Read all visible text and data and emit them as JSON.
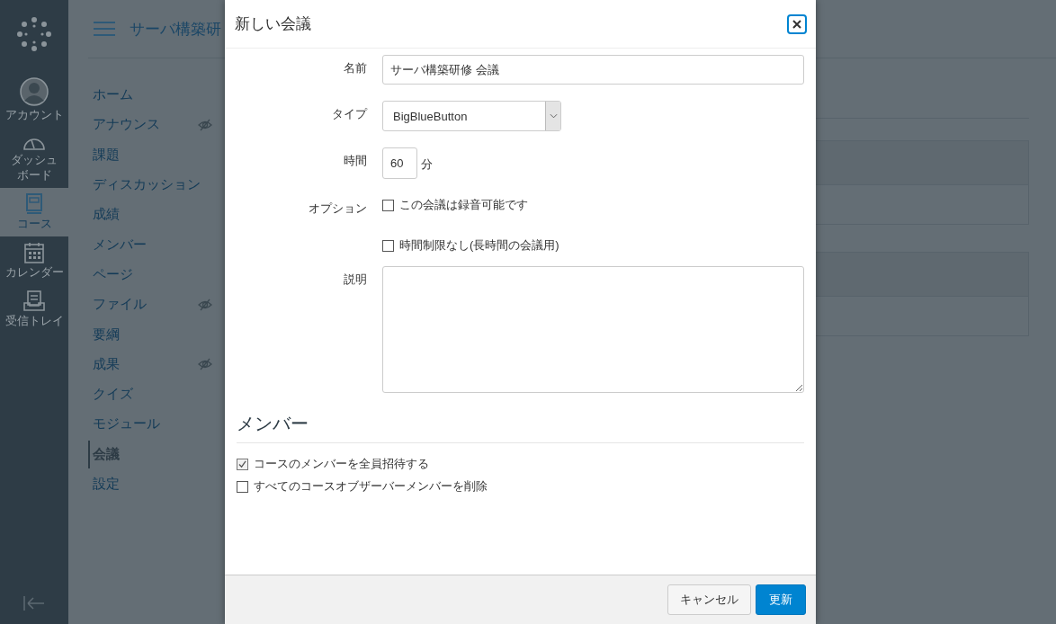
{
  "global_nav": {
    "items": [
      {
        "kind": "account",
        "label": "アカウント",
        "selected": false
      },
      {
        "kind": "dashboard",
        "label": "ダッシュボード",
        "selected": false
      },
      {
        "kind": "courses",
        "label": "コース",
        "selected": true
      },
      {
        "kind": "calendar",
        "label": "カレンダー",
        "selected": false
      },
      {
        "kind": "inbox",
        "label": "受信トレイ",
        "selected": false
      }
    ]
  },
  "course": {
    "title": "サーバ構築研"
  },
  "course_nav": {
    "items": [
      {
        "label": "ホーム",
        "hidden": false,
        "selected": false
      },
      {
        "label": "アナウンス",
        "hidden": true,
        "selected": false
      },
      {
        "label": "課題",
        "hidden": false,
        "selected": false
      },
      {
        "label": "ディスカッション",
        "hidden": false,
        "selected": false
      },
      {
        "label": "成績",
        "hidden": false,
        "selected": false
      },
      {
        "label": "メンバー",
        "hidden": false,
        "selected": false
      },
      {
        "label": "ページ",
        "hidden": false,
        "selected": false
      },
      {
        "label": "ファイル",
        "hidden": true,
        "selected": false
      },
      {
        "label": "要綱",
        "hidden": false,
        "selected": false
      },
      {
        "label": "成果",
        "hidden": true,
        "selected": false
      },
      {
        "label": "クイズ",
        "hidden": false,
        "selected": false
      },
      {
        "label": "モジュール",
        "hidden": false,
        "selected": false
      },
      {
        "label": "会議",
        "hidden": false,
        "selected": true
      },
      {
        "label": "設定",
        "hidden": false,
        "selected": false
      }
    ]
  },
  "dialog": {
    "title": "新しい会議",
    "name": {
      "label": "名前",
      "value": "サーバ構築研修 会議"
    },
    "type": {
      "label": "タイプ",
      "value": "BigBlueButton"
    },
    "duration": {
      "label": "時間",
      "value": "60",
      "unit": "分"
    },
    "options": {
      "label": "オプション",
      "items": [
        {
          "label": "この会議は録音可能です",
          "checked": false
        },
        {
          "label": "時間制限なし(長時間の会議用)",
          "checked": false
        }
      ]
    },
    "description": {
      "label": "説明"
    },
    "members": {
      "heading": "メンバー",
      "items": [
        {
          "label": "コースのメンバーを全員招待する",
          "checked": true
        },
        {
          "label": "すべてのコースオブザーバーメンバーを削除",
          "checked": false
        }
      ]
    },
    "buttons": {
      "cancel": "キャンセル",
      "submit": "更新"
    }
  }
}
